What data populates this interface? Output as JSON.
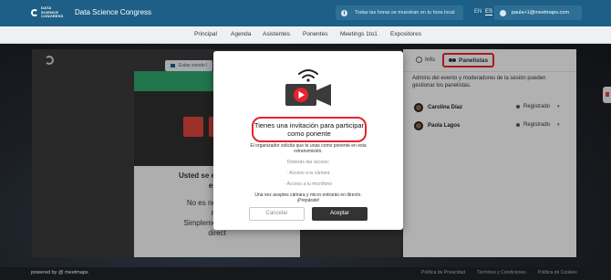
{
  "header": {
    "logo_lines": [
      "DATA",
      "SCIENCE",
      "CONGRESS"
    ],
    "event_title": "Data Science Congress",
    "timezone_notice": "Todas las horas se muestran en tu hora local",
    "languages": [
      "EN",
      "ES"
    ],
    "active_language": "ES",
    "user_email": "paula+1@meetmaps.com"
  },
  "nav": {
    "items": [
      "Principal",
      "Agenda",
      "Asistentes",
      "Ponentes",
      "Meetings 1to1",
      "Expositores"
    ]
  },
  "preview": {
    "camera_tag": "Estas viendo l",
    "line1": "Usted se está conecta",
    "line2": "espe",
    "line3": "No es necesario el",
    "line4": "mic",
    "line5": "Simplemente haga c",
    "line6": "direct"
  },
  "side_panel": {
    "tabs": [
      "Info",
      "Panelistas"
    ],
    "active_tab": "Panelistas",
    "description": "Admins del evento y moderadores de la sesión pueden gestionar los panelistas.",
    "speakers": [
      {
        "name": "Carolina Díaz",
        "status": "Registrado"
      },
      {
        "name": "Paola Lagos",
        "status": "Registrado"
      }
    ]
  },
  "modal": {
    "title": "Tienes una invitación para participar como ponente",
    "subtitle": "El organizador solicita que te unas como ponente en esta retransmisión.",
    "permissions_intro": "Deberás dar acceso:",
    "permission_camera": "· Acceso a tu cámara",
    "permission_mic": "· Acceso a tu micrófono",
    "note": "Una vez aceptes cámara y micro entrarás en directo.",
    "ready": "¡Prepárate!",
    "cancel_label": "Cancelar",
    "accept_label": "Aceptar"
  },
  "footer": {
    "powered_by": "powered by @ meetmaps",
    "links": [
      "Política de Privacidad",
      "Términos y Condiciones",
      "Política de Cookies"
    ]
  },
  "colors": {
    "header_bg": "#1d5f86",
    "highlight_red": "#e8232d",
    "accept_button": "#333333",
    "camera_red": "#d9443b"
  }
}
